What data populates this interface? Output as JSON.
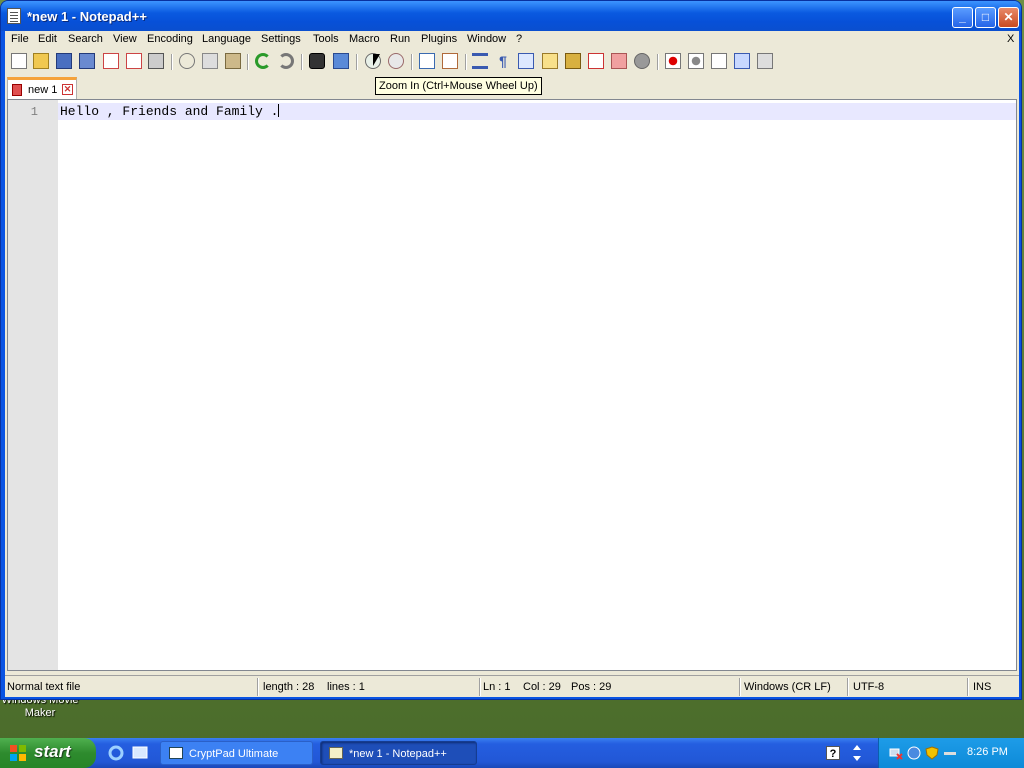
{
  "window": {
    "title": "*new 1 - Notepad++",
    "mdi_close": "X"
  },
  "menu": [
    "File",
    "Edit",
    "Search",
    "View",
    "Encoding",
    "Language",
    "Settings",
    "Tools",
    "Macro",
    "Run",
    "Plugins",
    "Window",
    "?"
  ],
  "toolbar": {
    "icons": [
      "new-file",
      "open-file",
      "save",
      "save-all",
      "close",
      "close-all",
      "print",
      "cut",
      "copy",
      "paste",
      "undo",
      "redo",
      "find",
      "replace",
      "zoom-in",
      "zoom-out",
      "sync-vertical",
      "sync-horizontal",
      "word-wrap",
      "show-all-chars",
      "indent-guide",
      "user-defined-dialog",
      "document-map",
      "function-list",
      "folder-as-workspace",
      "monitoring",
      "record-macro",
      "stop-recording",
      "playback-macro",
      "run-macro-multiple",
      "save-macro"
    ]
  },
  "tooltip": "Zoom In (Ctrl+Mouse Wheel Up)",
  "tabs": [
    {
      "label": "new 1",
      "active": true
    }
  ],
  "editor": {
    "line_number": "1",
    "text": "Hello , Friends and Family ."
  },
  "status": {
    "file_type": "Normal text file",
    "length": "length : 28",
    "lines": "lines : 1",
    "ln": "Ln : 1",
    "col": "Col : 29",
    "pos": "Pos : 29",
    "eol": "Windows (CR LF)",
    "encoding": "UTF-8",
    "mode": "INS"
  },
  "desktop": {
    "icon_label": "Windows Movie Maker"
  },
  "taskbar": {
    "start_label": "start",
    "tasks": [
      {
        "label": "CryptPad Ultimate"
      },
      {
        "label": "*new 1 - Notepad++"
      }
    ],
    "clock": "8:26 PM"
  },
  "colors": {
    "xp_blue": "#0a54e3",
    "current_line": "#e8e8ff",
    "tooltip_bg": "#ffffe1",
    "start_green": "#2e8b2e"
  }
}
